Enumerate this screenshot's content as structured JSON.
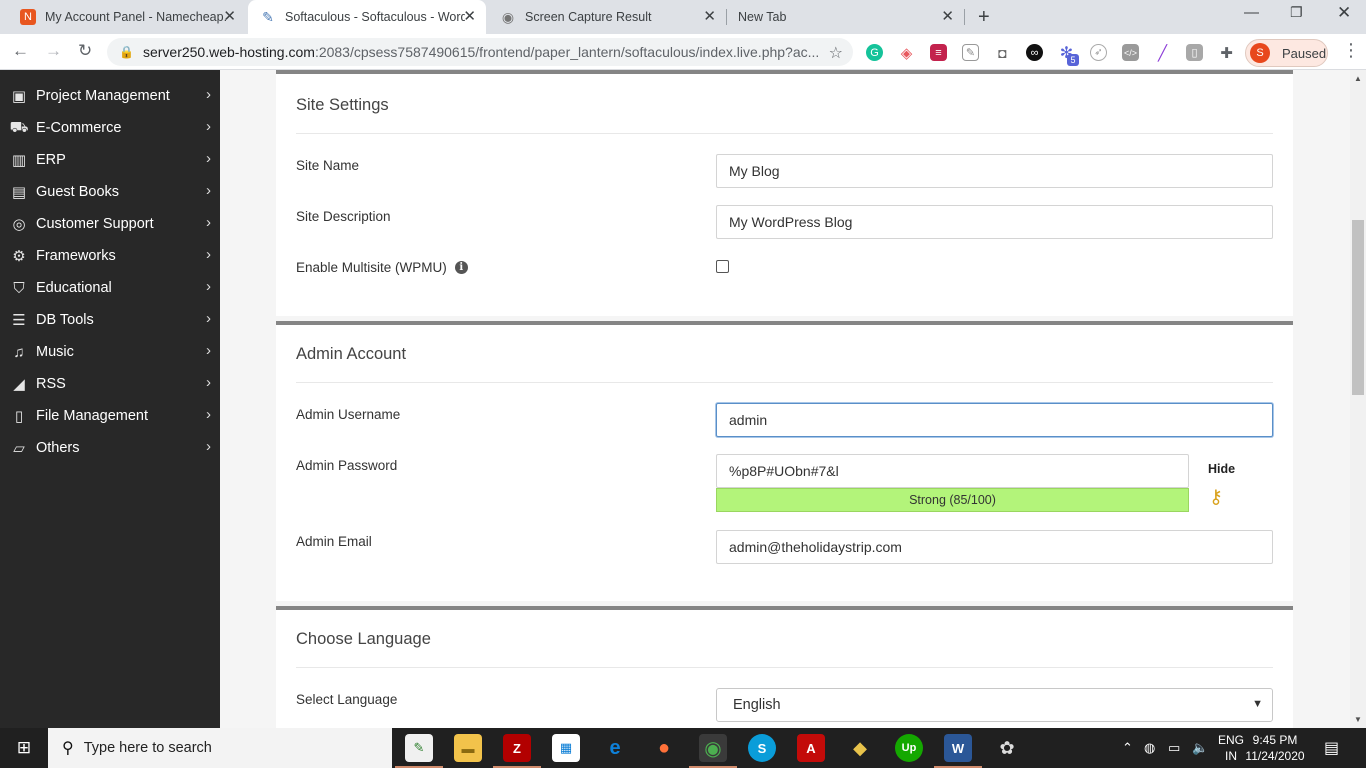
{
  "browser": {
    "tabs": [
      {
        "title": "My Account Panel - Namecheap.",
        "favicon": "namecheap-icon",
        "color": "#e8561f"
      },
      {
        "title": "Softaculous - Softaculous - Word",
        "favicon": "softaculous-icon",
        "color": "#4a7ab5"
      },
      {
        "title": "Screen Capture Result",
        "favicon": "camera-icon",
        "color": "#757575"
      },
      {
        "title": "New Tab",
        "favicon": "",
        "color": ""
      }
    ],
    "new_tab_glyph": "+",
    "url_host": "server250.web-hosting.com",
    "url_path": ":2083/cpsess7587490615/frontend/paper_lantern/softaculous/index.live.php?ac...",
    "extension_badge": "5",
    "profile_initial": "S",
    "profile_status": "Paused"
  },
  "sidebar": {
    "items": [
      {
        "label": "Project Management",
        "icon": "briefcase-icon",
        "glyph": "💼"
      },
      {
        "label": "E-Commerce",
        "icon": "cart-icon",
        "glyph": "🛒"
      },
      {
        "label": "ERP",
        "icon": "bar-chart-icon",
        "glyph": "📊"
      },
      {
        "label": "Guest Books",
        "icon": "book-icon",
        "glyph": "📖"
      },
      {
        "label": "Customer Support",
        "icon": "life-ring-icon",
        "glyph": "◎"
      },
      {
        "label": "Frameworks",
        "icon": "gears-icon",
        "glyph": "⚙"
      },
      {
        "label": "Educational",
        "icon": "graduation-cap-icon",
        "glyph": "🎓"
      },
      {
        "label": "DB Tools",
        "icon": "database-icon",
        "glyph": "☰"
      },
      {
        "label": "Music",
        "icon": "music-icon",
        "glyph": "♫"
      },
      {
        "label": "RSS",
        "icon": "rss-icon",
        "glyph": "◢"
      },
      {
        "label": "File Management",
        "icon": "file-icon",
        "glyph": "🗎"
      },
      {
        "label": "Others",
        "icon": "folder-open-icon",
        "glyph": "📂"
      }
    ]
  },
  "site_settings": {
    "title": "Site Settings",
    "site_name_label": "Site Name",
    "site_name_value": "My Blog",
    "site_description_label": "Site Description",
    "site_description_value": "My WordPress Blog",
    "multisite_label": "Enable Multisite (WPMU)",
    "multisite_checked": false
  },
  "admin_account": {
    "title": "Admin Account",
    "username_label": "Admin Username",
    "username_value": "admin",
    "password_label": "Admin Password",
    "password_value": "%p8P#UObn#7&l",
    "strength_text": "Strong (85/100)",
    "hide_label": "Hide",
    "email_label": "Admin Email",
    "email_value": "admin@theholidaystrip.com"
  },
  "choose_language": {
    "title": "Choose Language",
    "select_label": "Select Language",
    "selected_value": "English"
  },
  "taskbar": {
    "search_placeholder": "Type here to search",
    "lang_line1": "ENG",
    "lang_line2": "IN",
    "time": "9:45 PM",
    "date": "11/24/2020"
  },
  "colors": {
    "sidebar_bg": "#282828",
    "strength_green": "#b3f47a",
    "panel_border": "#858585",
    "focus_blue": "#5a8fc8"
  }
}
